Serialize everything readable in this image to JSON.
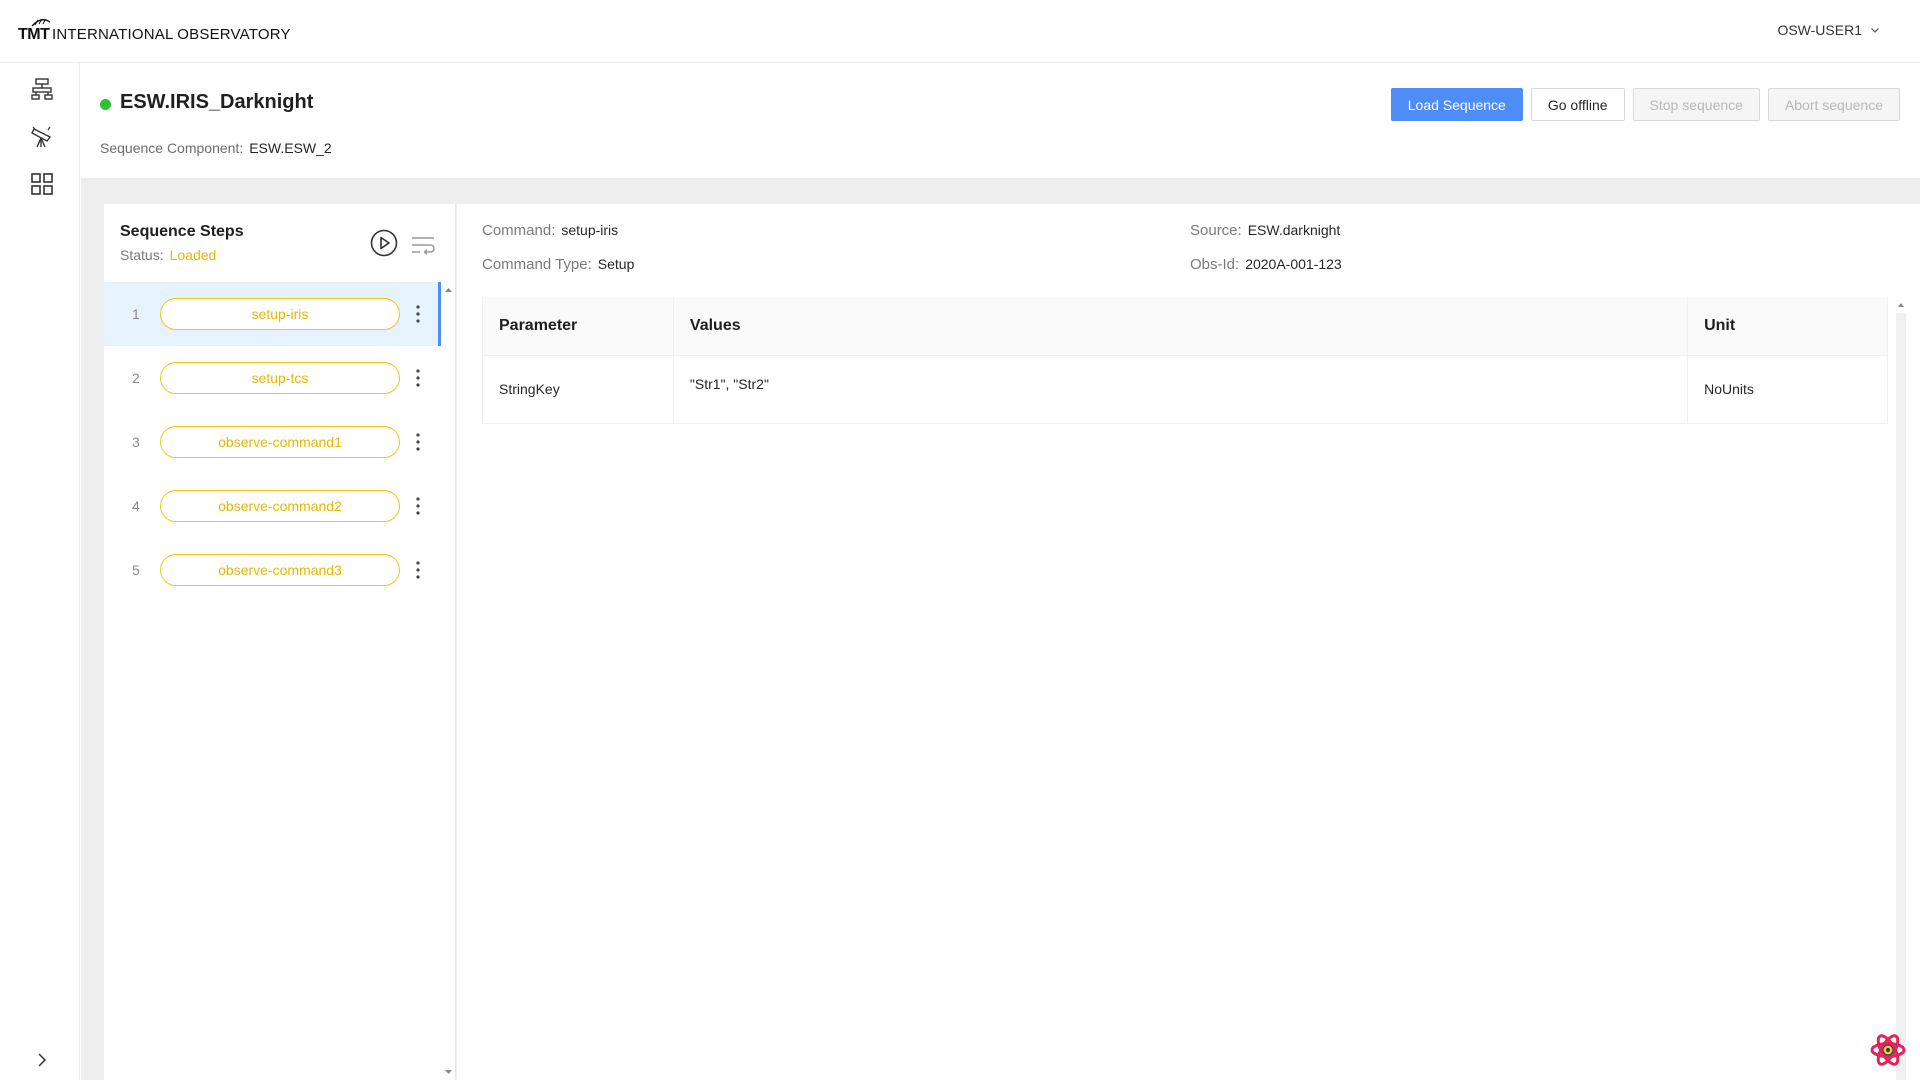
{
  "header": {
    "logo_mark": "TMT",
    "logo_text": "INTERNATIONAL OBSERVATORY",
    "user": "OSW-USER1"
  },
  "nav": {
    "icons": [
      "sitemap-icon",
      "telescope-icon",
      "grid-icon"
    ],
    "collapse_icon": "chevron-right-icon"
  },
  "sequencer": {
    "name": "ESW.IRIS_Darknight",
    "status_color": "#2fc22f",
    "component_label": "Sequence Component:",
    "component_value": "ESW.ESW_2",
    "buttons": {
      "load": "Load Sequence",
      "offline": "Go offline",
      "stop": "Stop sequence",
      "abort": "Abort sequence"
    }
  },
  "steps": {
    "title": "Sequence Steps",
    "status_label": "Status:",
    "status_value": "Loaded",
    "items": [
      {
        "num": "1",
        "label": "setup-iris"
      },
      {
        "num": "2",
        "label": "setup-tcs"
      },
      {
        "num": "3",
        "label": "observe-command1"
      },
      {
        "num": "4",
        "label": "observe-command2"
      },
      {
        "num": "5",
        "label": "observe-command3"
      }
    ]
  },
  "details": {
    "command_label": "Command:",
    "command_value": "setup-iris",
    "type_label": "Command Type:",
    "type_value": "Setup",
    "source_label": "Source:",
    "source_value": "ESW.darknight",
    "obsid_label": "Obs-Id:",
    "obsid_value": "2020A-001-123",
    "table": {
      "headers": [
        "Parameter",
        "Values",
        "Unit"
      ],
      "rows": [
        [
          "StringKey",
          "\"Str1\", \"Str2\"",
          "NoUnits"
        ]
      ]
    }
  },
  "colors": {
    "primary": "#4e8cf7",
    "step_accent": "#f0c51a",
    "status_loaded": "#f0b400"
  }
}
